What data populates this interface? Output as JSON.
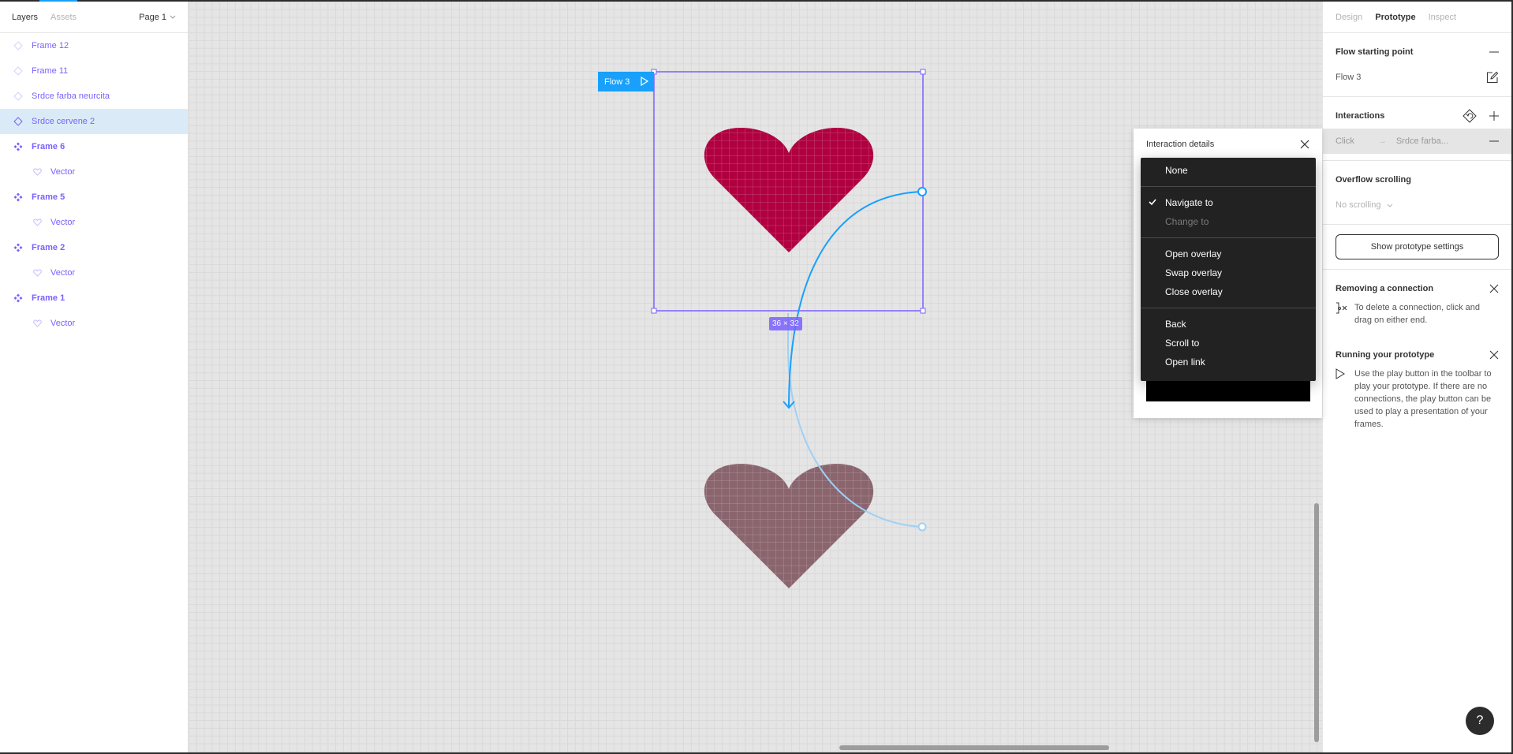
{
  "left_panel": {
    "tabs": {
      "layers": "Layers",
      "assets": "Assets"
    },
    "page_selector": "Page 1",
    "layers": [
      {
        "name": "Frame 12",
        "type": "component-instance",
        "level": 0,
        "selected": false
      },
      {
        "name": "Frame 11",
        "type": "component-instance",
        "level": 0,
        "selected": false
      },
      {
        "name": "Srdce farba neurcita",
        "type": "component-instance",
        "level": 0,
        "selected": false
      },
      {
        "name": "Srdce cervene 2",
        "type": "component-instance",
        "level": 0,
        "selected": true
      },
      {
        "name": "Frame 6",
        "type": "component",
        "level": 0,
        "selected": false
      },
      {
        "name": "Vector",
        "type": "vector",
        "level": 1,
        "selected": false
      },
      {
        "name": "Frame 5",
        "type": "component",
        "level": 0,
        "selected": false
      },
      {
        "name": "Vector",
        "type": "vector",
        "level": 1,
        "selected": false
      },
      {
        "name": "Frame 2",
        "type": "component",
        "level": 0,
        "selected": false
      },
      {
        "name": "Vector",
        "type": "vector",
        "level": 1,
        "selected": false
      },
      {
        "name": "Frame 1",
        "type": "component",
        "level": 0,
        "selected": false
      },
      {
        "name": "Vector",
        "type": "vector",
        "level": 1,
        "selected": false
      }
    ]
  },
  "canvas": {
    "flow_label": "Flow 3",
    "size_badge": "36 × 32",
    "colors": {
      "selection": "#7b61ff",
      "connector": "#18a0fb",
      "heart_red": "#b00040",
      "heart_muted": "#8a656e"
    }
  },
  "interaction_details": {
    "title": "Interaction details",
    "dropdown": {
      "groups": [
        [
          {
            "label": "None",
            "checked": false,
            "disabled": false
          }
        ],
        [
          {
            "label": "Navigate to",
            "checked": true,
            "disabled": false
          },
          {
            "label": "Change to",
            "checked": false,
            "disabled": true
          }
        ],
        [
          {
            "label": "Open overlay",
            "checked": false,
            "disabled": false
          },
          {
            "label": "Swap overlay",
            "checked": false,
            "disabled": false
          },
          {
            "label": "Close overlay",
            "checked": false,
            "disabled": false
          }
        ],
        [
          {
            "label": "Back",
            "checked": false,
            "disabled": false
          },
          {
            "label": "Scroll to",
            "checked": false,
            "disabled": false
          },
          {
            "label": "Open link",
            "checked": false,
            "disabled": false
          }
        ]
      ]
    }
  },
  "right_panel": {
    "tabs": {
      "design": "Design",
      "prototype": "Prototype",
      "inspect": "Inspect"
    },
    "flow_starting_point": {
      "title": "Flow starting point",
      "flow_name": "Flow 3"
    },
    "interactions": {
      "title": "Interactions",
      "trigger": "Click",
      "arrow": "→",
      "target": "Srdce farba..."
    },
    "overflow": {
      "title": "Overflow scrolling",
      "value": "No scrolling"
    },
    "show_settings_button": "Show prototype settings",
    "removing": {
      "title": "Removing a connection",
      "text": "To delete a connection, click and drag on either end."
    },
    "running": {
      "title": "Running your prototype",
      "text": "Use the play button in the toolbar to play your prototype. If there are no connections, the play button can be used to play a presentation of your frames."
    },
    "help_button": "?"
  }
}
